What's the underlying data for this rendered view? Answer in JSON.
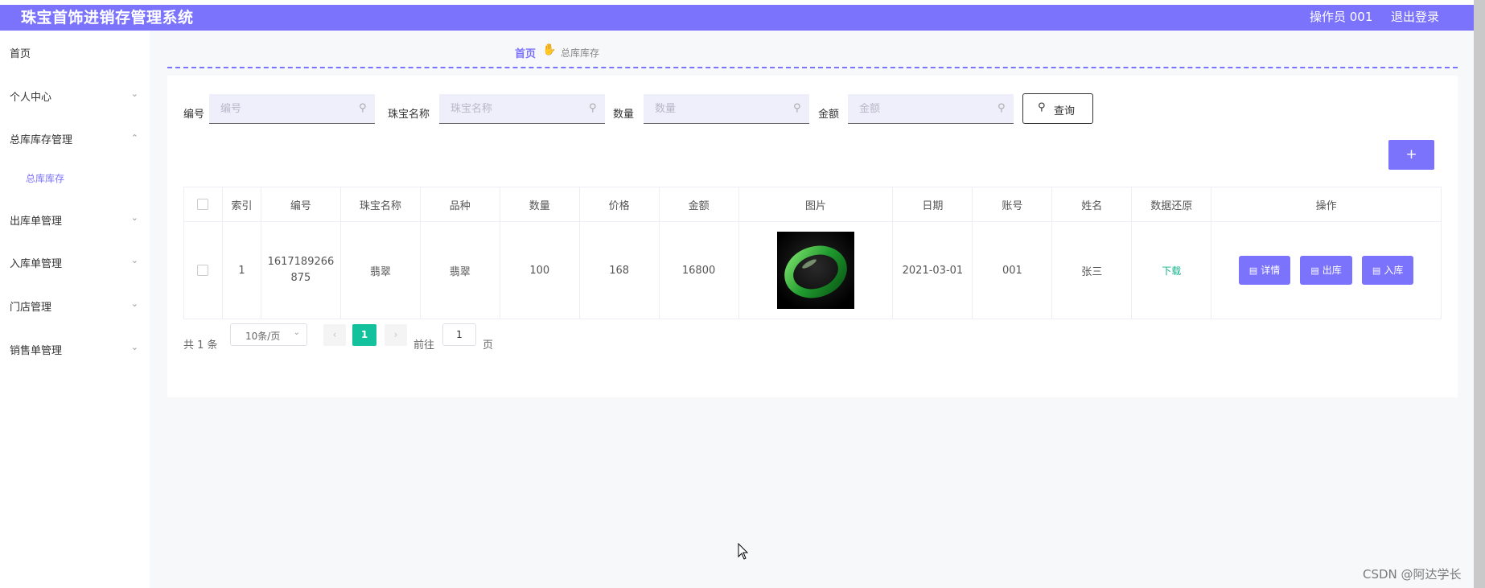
{
  "header": {
    "title": "珠宝首饰进销存管理系统",
    "user": "操作员 001",
    "logout": "退出登录"
  },
  "sidebar": {
    "items": [
      {
        "label": "首页"
      },
      {
        "label": "个人中心"
      },
      {
        "label": "总库库存管理"
      },
      {
        "label": "总库库存"
      },
      {
        "label": "出库单管理"
      },
      {
        "label": "入库单管理"
      },
      {
        "label": "门店管理"
      },
      {
        "label": "销售单管理"
      }
    ]
  },
  "breadcrumb": {
    "home": "首页",
    "current": "总库库存"
  },
  "filters": [
    {
      "label": "编号",
      "placeholder": "编号"
    },
    {
      "label": "珠宝名称",
      "placeholder": "珠宝名称"
    },
    {
      "label": "数量",
      "placeholder": "数量"
    },
    {
      "label": "金额",
      "placeholder": "金额"
    }
  ],
  "query_label": "查询",
  "add_label": "+",
  "table": {
    "headers": [
      "索引",
      "编号",
      "珠宝名称",
      "品种",
      "数量",
      "价格",
      "金额",
      "图片",
      "日期",
      "账号",
      "姓名",
      "数据还原",
      "操作"
    ],
    "rows": [
      {
        "index": "1",
        "code_line1": "1617189266",
        "code_line2": "875",
        "name": "翡翠",
        "variety": "翡翠",
        "qty": "100",
        "price": "168",
        "amount": "16800",
        "date": "2021-03-01",
        "account": "001",
        "person": "张三",
        "restore": "下载",
        "actions": [
          "详情",
          "出库",
          "入库"
        ]
      }
    ]
  },
  "pagination": {
    "total": "共 1 条",
    "page_size": "10条/页",
    "current_page": "1",
    "goto_label": "前往",
    "goto_value": "1",
    "page_suffix": "页"
  },
  "watermark": "CSDN @阿达学长",
  "colors": {
    "primary": "#7b73fc",
    "accent": "#13c29c"
  }
}
